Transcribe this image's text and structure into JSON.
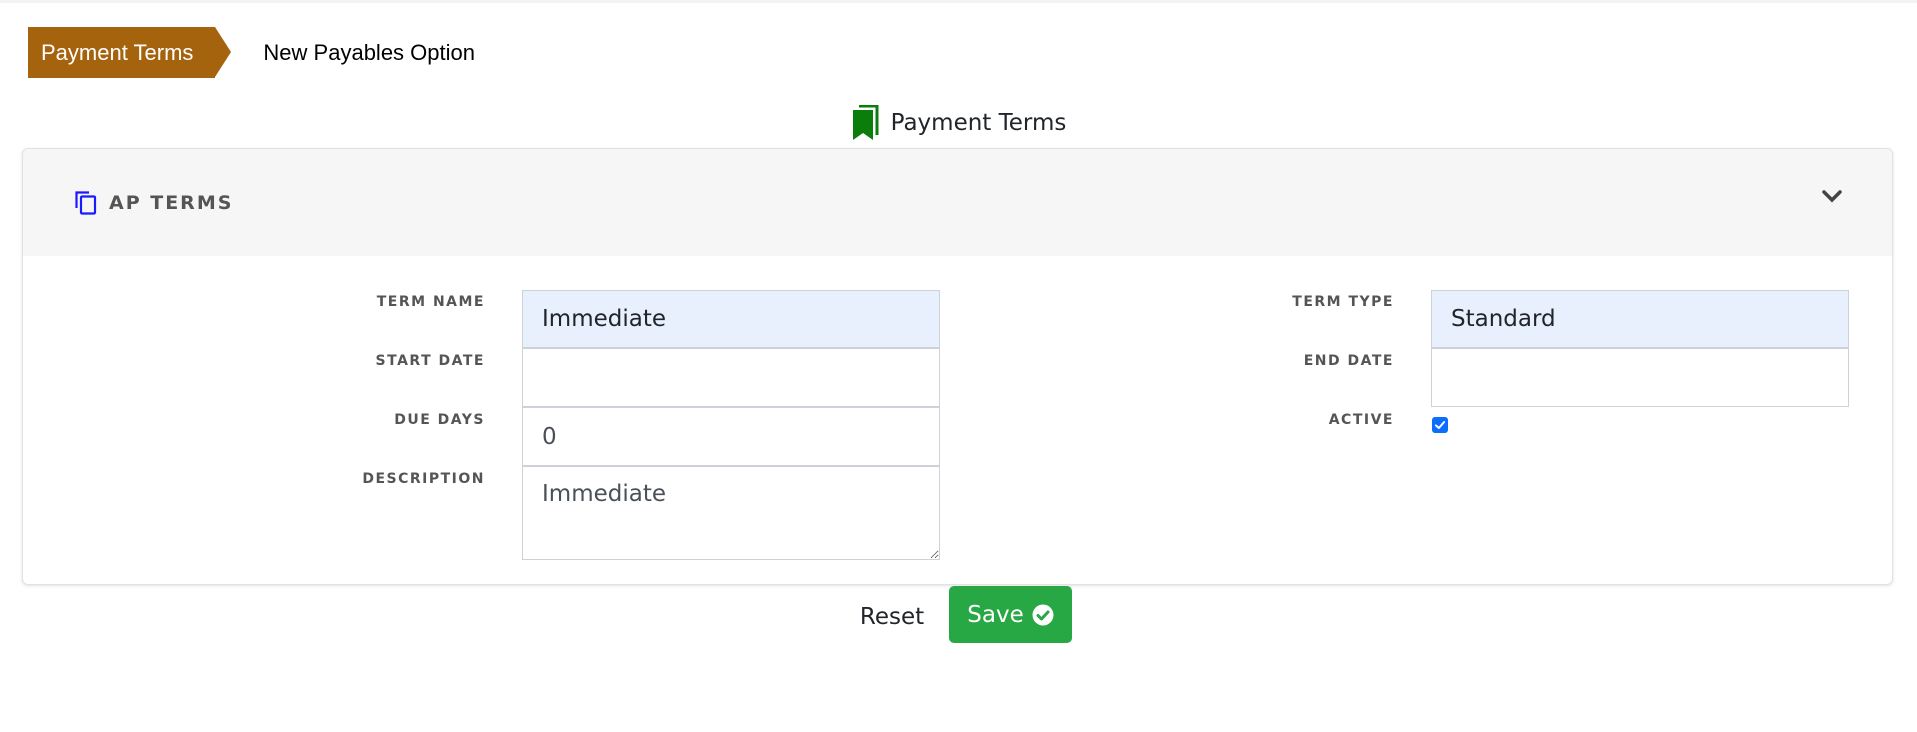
{
  "breadcrumb": {
    "items": [
      {
        "label": "Payment Terms",
        "active": true
      },
      {
        "label": "New Payables Option",
        "active": false
      }
    ]
  },
  "page": {
    "title": "Payment Terms",
    "title_icon": "bookmarks-icon"
  },
  "section": {
    "title": "AP TERMS",
    "icon": "copy-icon",
    "collapse_icon": "chevron-down-icon"
  },
  "form": {
    "term_name": {
      "label": "TERM NAME",
      "value": "Immediate"
    },
    "start_date": {
      "label": "START DATE",
      "value": ""
    },
    "due_days": {
      "label": "DUE DAYS",
      "value": "0"
    },
    "description": {
      "label": "DESCRIPTION",
      "value": "Immediate"
    },
    "term_type": {
      "label": "TERM TYPE",
      "value": "Standard"
    },
    "end_date": {
      "label": "END DATE",
      "value": ""
    },
    "active": {
      "label": "ACTIVE",
      "checked": true
    }
  },
  "actions": {
    "reset_label": "Reset",
    "save_label": "Save",
    "save_icon": "check-circle-icon"
  },
  "colors": {
    "breadcrumb_active": "#a5630e",
    "title_icon": "#0a7d0a",
    "section_icon": "#1a1aff",
    "autofill_bg": "#e8f0fe",
    "save_button": "#28a745",
    "checkbox": "#0d6efd"
  }
}
